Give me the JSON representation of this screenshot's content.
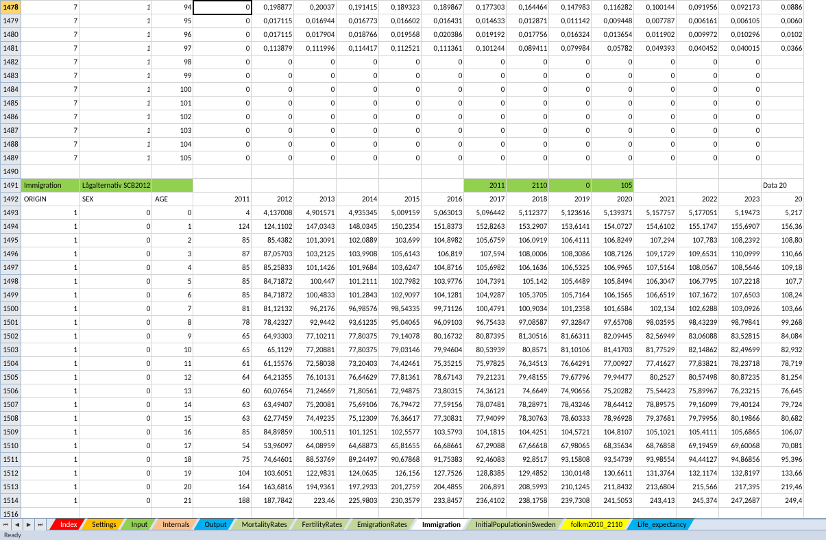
{
  "status": "Ready",
  "activeRowHeader": "1478",
  "tabs": [
    {
      "label": "Index",
      "bg": "#ff0000",
      "fg": "#fff"
    },
    {
      "label": "Settings",
      "bg": "#ffc000",
      "fg": "#000"
    },
    {
      "label": "Input",
      "bg": "#92d050",
      "fg": "#000"
    },
    {
      "label": "Internals",
      "bg": "#fac090",
      "fg": "#000"
    },
    {
      "label": "Output",
      "bg": "#00b0f0",
      "fg": "#000"
    },
    {
      "label": "MortalityRates",
      "bg": "#c4d79b",
      "fg": "#000"
    },
    {
      "label": "FertilityRates",
      "bg": "#c4d79b",
      "fg": "#000"
    },
    {
      "label": "EmigrationRates",
      "bg": "#c4d79b",
      "fg": "#000"
    },
    {
      "label": "Immigration",
      "bg": "#ffffff",
      "fg": "#000",
      "active": true
    },
    {
      "label": "InitialPopulationinSweden",
      "bg": "#c4d79b",
      "fg": "#000"
    },
    {
      "label": "folkm2010_2110",
      "bg": "#ffff00",
      "fg": "#000"
    },
    {
      "label": "Life_expectancy",
      "bg": "#00b0f0",
      "fg": "#000"
    }
  ],
  "rows": [
    {
      "num": "1478",
      "active": true,
      "cells": [
        "7",
        "1",
        "94",
        "0",
        "0,198877",
        "0,20037",
        "0,191415",
        "0,189323",
        "0,189867",
        "0,177303",
        "0,164464",
        "0,147983",
        "0,116282",
        "0,100144",
        "0,091956",
        "0,092173",
        "0,0886"
      ]
    },
    {
      "num": "1479",
      "cells": [
        "7",
        "1",
        "95",
        "0",
        "0,017115",
        "0,016944",
        "0,016773",
        "0,016602",
        "0,016431",
        "0,014633",
        "0,012871",
        "0,011142",
        "0,009448",
        "0,007787",
        "0,006161",
        "0,006105",
        "0,0060"
      ]
    },
    {
      "num": "1480",
      "cells": [
        "7",
        "1",
        "96",
        "0",
        "0,017115",
        "0,017904",
        "0,018766",
        "0,019568",
        "0,020386",
        "0,019192",
        "0,017756",
        "0,016324",
        "0,013654",
        "0,011902",
        "0,009972",
        "0,010296",
        "0,0102"
      ]
    },
    {
      "num": "1481",
      "cells": [
        "7",
        "1",
        "97",
        "0",
        "0,113879",
        "0,111996",
        "0,114417",
        "0,112521",
        "0,111361",
        "0,101244",
        "0,089411",
        "0,079984",
        "0,05782",
        "0,049393",
        "0,040452",
        "0,040015",
        "0,0366"
      ]
    },
    {
      "num": "1482",
      "cells": [
        "7",
        "1",
        "98",
        "0",
        "0",
        "0",
        "0",
        "0",
        "0",
        "0",
        "0",
        "0",
        "0",
        "0",
        "0",
        "0",
        ""
      ]
    },
    {
      "num": "1483",
      "cells": [
        "7",
        "1",
        "99",
        "0",
        "0",
        "0",
        "0",
        "0",
        "0",
        "0",
        "0",
        "0",
        "0",
        "0",
        "0",
        "0",
        ""
      ]
    },
    {
      "num": "1484",
      "cells": [
        "7",
        "1",
        "100",
        "0",
        "0",
        "0",
        "0",
        "0",
        "0",
        "0",
        "0",
        "0",
        "0",
        "0",
        "0",
        "0",
        ""
      ]
    },
    {
      "num": "1485",
      "cells": [
        "7",
        "1",
        "101",
        "0",
        "0",
        "0",
        "0",
        "0",
        "0",
        "0",
        "0",
        "0",
        "0",
        "0",
        "0",
        "0",
        ""
      ]
    },
    {
      "num": "1486",
      "cells": [
        "7",
        "1",
        "102",
        "0",
        "0",
        "0",
        "0",
        "0",
        "0",
        "0",
        "0",
        "0",
        "0",
        "0",
        "0",
        "0",
        ""
      ]
    },
    {
      "num": "1487",
      "cells": [
        "7",
        "1",
        "103",
        "0",
        "0",
        "0",
        "0",
        "0",
        "0",
        "0",
        "0",
        "0",
        "0",
        "0",
        "0",
        "0",
        ""
      ]
    },
    {
      "num": "1488",
      "cells": [
        "7",
        "1",
        "104",
        "0",
        "0",
        "0",
        "0",
        "0",
        "0",
        "0",
        "0",
        "0",
        "0",
        "0",
        "0",
        "0",
        ""
      ]
    },
    {
      "num": "1489",
      "cells": [
        "7",
        "1",
        "105",
        "0",
        "0",
        "0",
        "0",
        "0",
        "0",
        "0",
        "0",
        "0",
        "0",
        "0",
        "0",
        "0",
        ""
      ]
    },
    {
      "num": "1490",
      "cells": [
        "",
        "",
        "",
        "",
        "",
        "",
        "",
        "",
        "",
        "",
        "",
        "",
        "",
        "",
        "",
        "",
        ""
      ]
    },
    {
      "num": "1491",
      "section": true,
      "cells": [
        "Immigration",
        "Lågalternativ SCB2012",
        "",
        "",
        "",
        "",
        "",
        "",
        "",
        "2011",
        "2110",
        "0",
        "105",
        "",
        "",
        "",
        "Data 20"
      ]
    },
    {
      "num": "1492",
      "headers": true,
      "cells": [
        "ORIGIN",
        "SEX",
        "AGE",
        "2011",
        "2012",
        "2013",
        "2014",
        "2015",
        "2016",
        "2017",
        "2018",
        "2019",
        "2020",
        "2021",
        "2022",
        "2023",
        "20"
      ]
    },
    {
      "num": "1493",
      "cells": [
        "1",
        "0",
        "0",
        "4",
        "4,137008",
        "4,901571",
        "4,935345",
        "5,009159",
        "5,063013",
        "5,096442",
        "5,112377",
        "5,123616",
        "5,139371",
        "5,157757",
        "5,177051",
        "5,19473",
        "5,217"
      ]
    },
    {
      "num": "1494",
      "cells": [
        "1",
        "0",
        "1",
        "124",
        "124,1102",
        "147,0343",
        "148,0345",
        "150,2354",
        "151,8373",
        "152,8263",
        "153,2907",
        "153,6141",
        "154,0727",
        "154,6102",
        "155,1747",
        "155,6907",
        "156,36"
      ]
    },
    {
      "num": "1495",
      "cells": [
        "1",
        "0",
        "2",
        "85",
        "85,4382",
        "101,3091",
        "102,0889",
        "103,699",
        "104,8982",
        "105,6759",
        "106,0919",
        "106,4111",
        "106,8249",
        "107,294",
        "107,783",
        "108,2392",
        "108,80"
      ]
    },
    {
      "num": "1496",
      "cells": [
        "1",
        "0",
        "3",
        "87",
        "87,05703",
        "103,2125",
        "103,9908",
        "105,6143",
        "106,819",
        "107,594",
        "108,0006",
        "108,3086",
        "108,7126",
        "109,1729",
        "109,6531",
        "110,0999",
        "110,66"
      ]
    },
    {
      "num": "1497",
      "cells": [
        "1",
        "0",
        "4",
        "85",
        "85,25833",
        "101,1426",
        "101,9684",
        "103,6247",
        "104,8716",
        "105,6982",
        "106,1636",
        "106,5325",
        "106,9965",
        "107,5164",
        "108,0567",
        "108,5646",
        "109,18"
      ]
    },
    {
      "num": "1498",
      "cells": [
        "1",
        "0",
        "5",
        "85",
        "84,71872",
        "100,447",
        "101,2111",
        "102,7982",
        "103,9776",
        "104,7391",
        "105,142",
        "105,4489",
        "105,8494",
        "106,3047",
        "106,7795",
        "107,2218",
        "107,7"
      ]
    },
    {
      "num": "1499",
      "cells": [
        "1",
        "0",
        "6",
        "85",
        "84,71872",
        "100,4833",
        "101,2843",
        "102,9097",
        "104,1281",
        "104,9287",
        "105,3705",
        "105,7164",
        "106,1565",
        "106,6519",
        "107,1672",
        "107,6503",
        "108,24"
      ]
    },
    {
      "num": "1500",
      "cells": [
        "1",
        "0",
        "7",
        "81",
        "81,12132",
        "96,2176",
        "96,98576",
        "98,54335",
        "99,71126",
        "100,4791",
        "100,9034",
        "101,2358",
        "101,6584",
        "102,134",
        "102,6288",
        "103,0926",
        "103,66"
      ]
    },
    {
      "num": "1501",
      "cells": [
        "1",
        "0",
        "8",
        "78",
        "78,42327",
        "92,9442",
        "93,61235",
        "95,04065",
        "96,09103",
        "96,75433",
        "97,08587",
        "97,32847",
        "97,65708",
        "98,03595",
        "98,43239",
        "98,79841",
        "99,268"
      ]
    },
    {
      "num": "1502",
      "cells": [
        "1",
        "0",
        "9",
        "65",
        "64,93303",
        "77,10211",
        "77,80375",
        "79,14078",
        "80,16732",
        "80,87395",
        "81,30516",
        "81,66311",
        "82,09445",
        "82,56949",
        "83,06088",
        "83,52815",
        "84,084"
      ]
    },
    {
      "num": "1503",
      "cells": [
        "1",
        "0",
        "10",
        "65",
        "65,1129",
        "77,20881",
        "77,80375",
        "79,03146",
        "79,94604",
        "80,53939",
        "80,8571",
        "81,10106",
        "81,41703",
        "81,77529",
        "82,14862",
        "82,49699",
        "82,932"
      ]
    },
    {
      "num": "1504",
      "cells": [
        "1",
        "0",
        "11",
        "61",
        "61,15576",
        "72,58038",
        "73,20403",
        "74,42461",
        "75,35215",
        "75,97825",
        "76,34513",
        "76,64291",
        "77,00927",
        "77,41627",
        "77,83821",
        "78,23718",
        "78,719"
      ]
    },
    {
      "num": "1505",
      "cells": [
        "1",
        "0",
        "12",
        "64",
        "64,21355",
        "76,10131",
        "76,64629",
        "77,81361",
        "78,67143",
        "79,21231",
        "79,48155",
        "79,67796",
        "79,94477",
        "80,2527",
        "80,57498",
        "80,87235",
        "81,254"
      ]
    },
    {
      "num": "1506",
      "cells": [
        "1",
        "0",
        "13",
        "60",
        "60,07654",
        "71,24669",
        "71,80561",
        "72,94875",
        "73,80315",
        "74,36121",
        "74,6649",
        "74,90656",
        "75,20282",
        "75,54423",
        "75,89967",
        "76,23215",
        "76,645"
      ]
    },
    {
      "num": "1507",
      "cells": [
        "1",
        "0",
        "14",
        "63",
        "63,49407",
        "75,20081",
        "75,69106",
        "76,79472",
        "77,59156",
        "78,07481",
        "78,28971",
        "78,43246",
        "78,64412",
        "78,89575",
        "79,16099",
        "79,40124",
        "79,724"
      ]
    },
    {
      "num": "1508",
      "cells": [
        "1",
        "0",
        "15",
        "63",
        "62,77459",
        "74,49235",
        "75,12309",
        "76,36617",
        "77,30831",
        "77,94099",
        "78,30763",
        "78,60333",
        "78,96928",
        "79,37681",
        "79,79956",
        "80,19866",
        "80,682"
      ]
    },
    {
      "num": "1509",
      "cells": [
        "1",
        "0",
        "16",
        "85",
        "84,89859",
        "100,511",
        "101,1251",
        "102,5577",
        "103,5793",
        "104,1815",
        "104,4251",
        "104,5721",
        "104,8107",
        "105,1021",
        "105,4111",
        "105,6865",
        "106,07"
      ]
    },
    {
      "num": "1510",
      "cells": [
        "1",
        "0",
        "17",
        "54",
        "53,96097",
        "64,08959",
        "64,68873",
        "65,81655",
        "66,68661",
        "67,29088",
        "67,66618",
        "67,98065",
        "68,35634",
        "68,76858",
        "69,19459",
        "69,60068",
        "70,081"
      ]
    },
    {
      "num": "1511",
      "cells": [
        "1",
        "0",
        "18",
        "75",
        "74,64601",
        "88,53769",
        "89,24497",
        "90,67868",
        "91,75383",
        "92,46083",
        "92,8517",
        "93,15808",
        "93,54739",
        "93,98554",
        "94,44127",
        "94,86856",
        "95,396"
      ]
    },
    {
      "num": "1512",
      "cells": [
        "1",
        "0",
        "19",
        "104",
        "103,6051",
        "122,9831",
        "124,0635",
        "126,156",
        "127,7526",
        "128,8385",
        "129,4852",
        "130,0148",
        "130,6611",
        "131,3764",
        "132,1174",
        "132,8197",
        "133,66"
      ]
    },
    {
      "num": "1513",
      "cells": [
        "1",
        "0",
        "20",
        "164",
        "163,6816",
        "194,9361",
        "197,2933",
        "201,2759",
        "204,4855",
        "206,891",
        "208,5993",
        "210,1245",
        "211,8432",
        "213,6804",
        "215,566",
        "217,395",
        "219,46"
      ]
    },
    {
      "num": "1514",
      "cells": [
        "1",
        "0",
        "21",
        "188",
        "187,7842",
        "223,46",
        "225,9803",
        "230,3579",
        "233,8457",
        "236,4102",
        "238,1758",
        "239,7308",
        "241,5053",
        "243,413",
        "245,374",
        "247,2687",
        "249,4"
      ]
    },
    {
      "num": "1516",
      "partial": true,
      "cells": [
        "",
        "",
        "",
        "",
        "",
        "",
        "",
        "",
        "",
        "",
        "",
        "",
        "",
        "",
        "",
        "",
        ""
      ]
    }
  ],
  "sectionRowIndex": 13,
  "headerRowIndex": 14,
  "greenCellsSection": {
    "10": true,
    "11": true,
    "12": true,
    "13": true
  }
}
